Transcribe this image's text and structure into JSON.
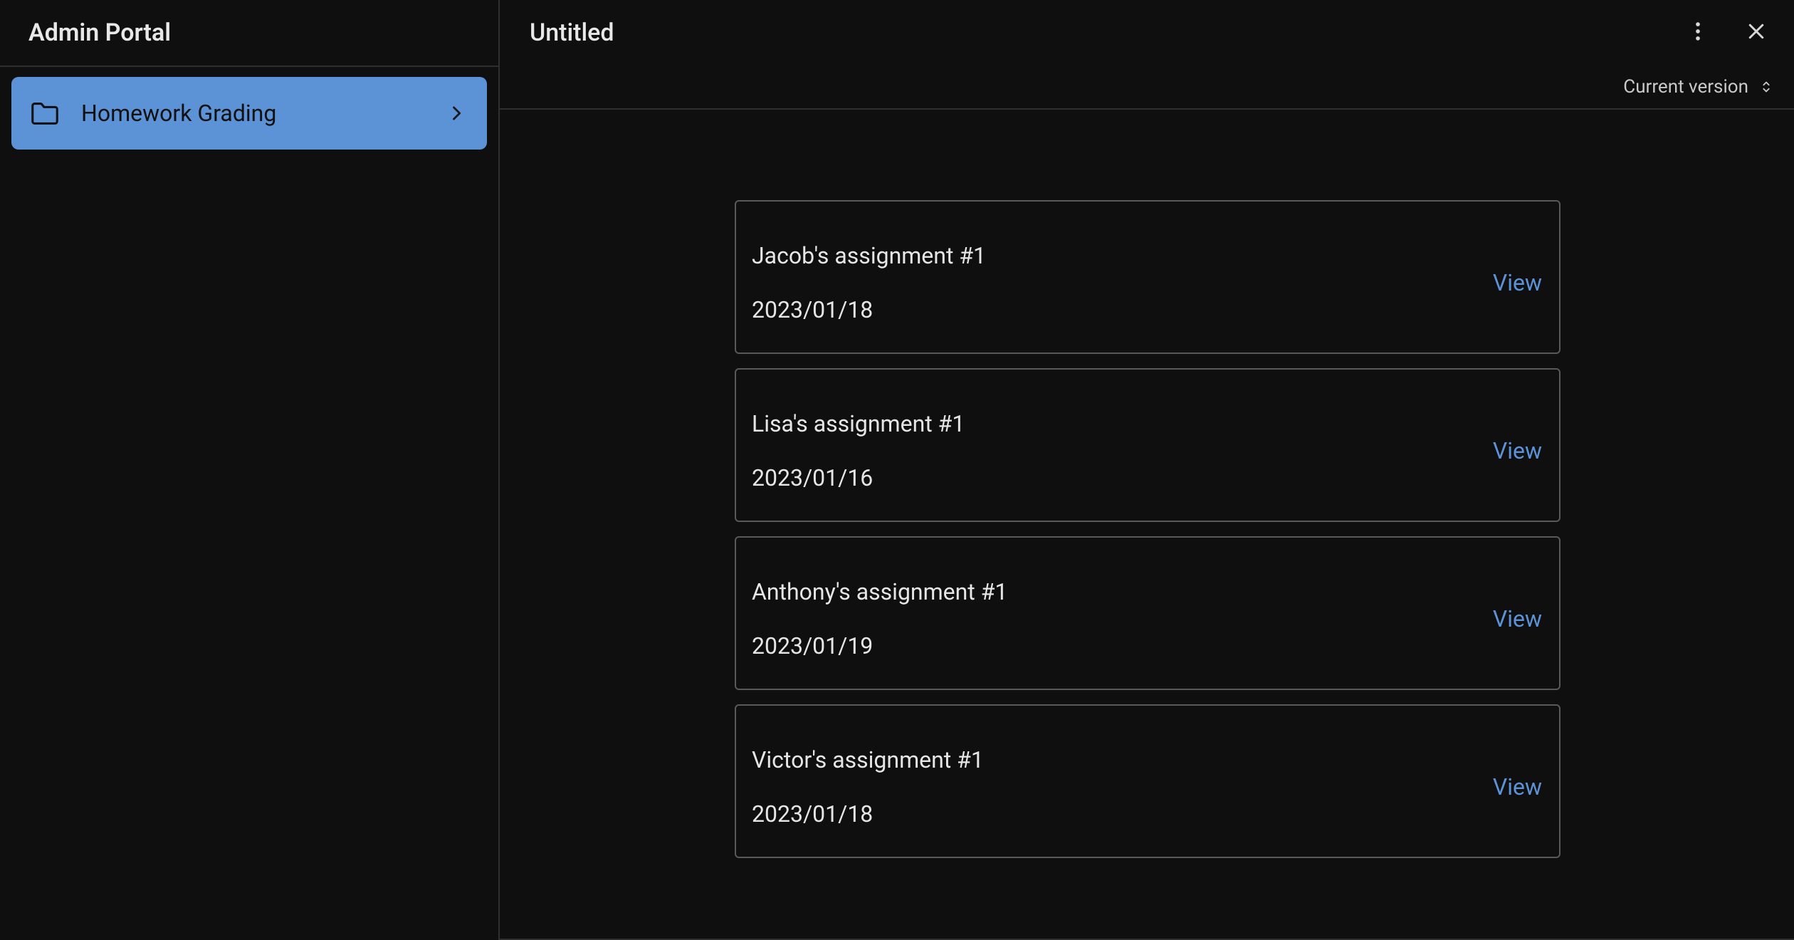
{
  "sidebar": {
    "title": "Admin Portal",
    "items": [
      {
        "label": "Homework Grading",
        "icon": "folder-icon"
      }
    ]
  },
  "header": {
    "title": "Untitled",
    "version_label": "Current version"
  },
  "assignments": {
    "view_label": "View",
    "items": [
      {
        "title": "Jacob's assignment #1",
        "date": "2023/01/18"
      },
      {
        "title": "Lisa's assignment #1",
        "date": "2023/01/16"
      },
      {
        "title": "Anthony's assignment #1",
        "date": "2023/01/19"
      },
      {
        "title": "Victor's assignment #1",
        "date": "2023/01/18"
      }
    ]
  }
}
